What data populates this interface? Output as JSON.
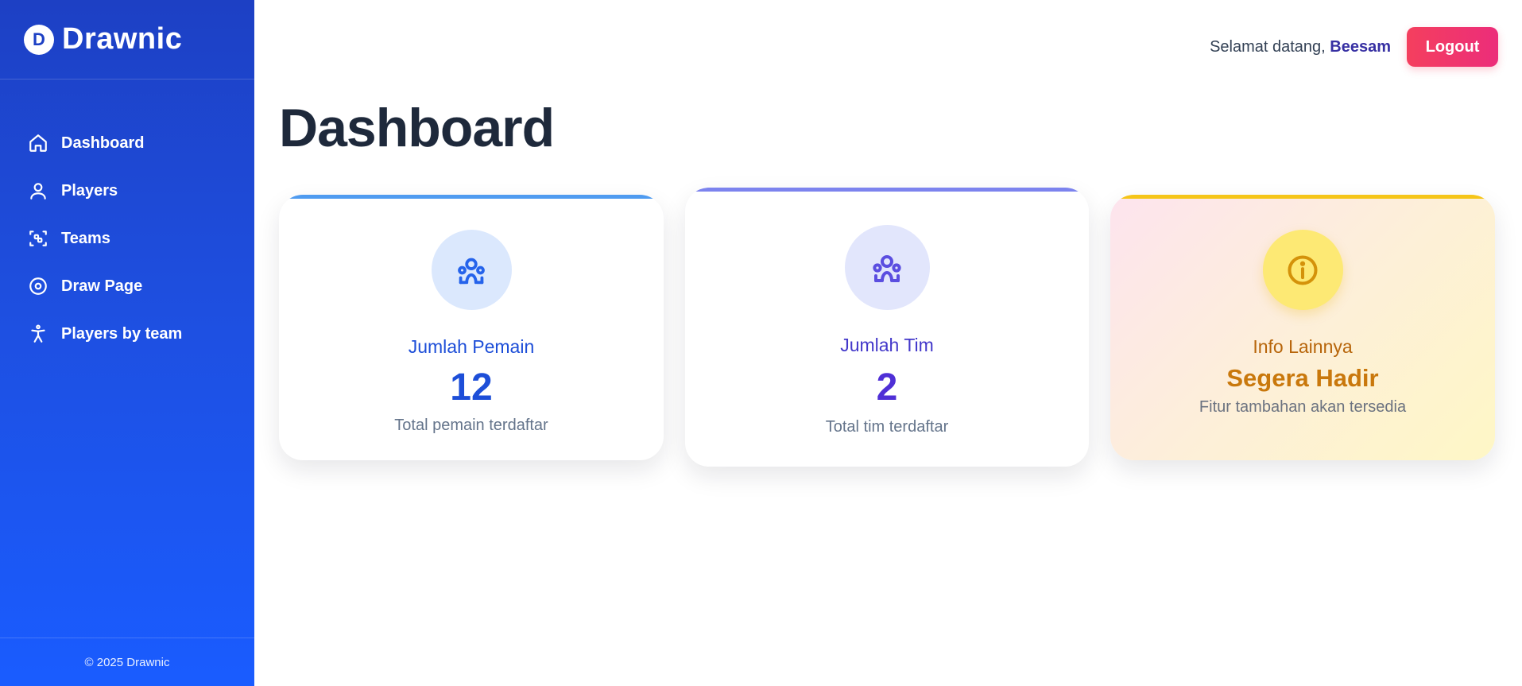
{
  "brand": {
    "logo_letter": "D",
    "name": "Drawnic"
  },
  "sidebar": {
    "items": [
      {
        "label": "Dashboard",
        "icon": "home-icon"
      },
      {
        "label": "Players",
        "icon": "user-icon"
      },
      {
        "label": "Teams",
        "icon": "scan-group-icon"
      },
      {
        "label": "Draw Page",
        "icon": "target-circle-icon"
      },
      {
        "label": "Players by team",
        "icon": "accessibility-person-icon"
      }
    ],
    "footer": "© 2025 Drawnic"
  },
  "header": {
    "welcome_prefix": "Selamat datang,",
    "username": "Beesam",
    "logout_label": "Logout"
  },
  "page": {
    "title": "Dashboard"
  },
  "cards": [
    {
      "label": "Jumlah Pemain",
      "value": "12",
      "subtitle": "Total pemain terdaftar",
      "icon": "users-icon",
      "accent": "#4f9bf0"
    },
    {
      "label": "Jumlah Tim",
      "value": "2",
      "subtitle": "Total tim terdaftar",
      "icon": "users-icon",
      "accent": "#7c83ee"
    },
    {
      "label": "Info Lainnya",
      "value": "Segera Hadir",
      "subtitle": "Fitur tambahan akan tersedia",
      "icon": "info-icon",
      "accent": "#f5c518"
    }
  ],
  "colors": {
    "sidebar_top": "#1d40c4",
    "sidebar_bottom": "#1a5cff",
    "logout": "#f43f5e",
    "title": "#1e293b"
  }
}
